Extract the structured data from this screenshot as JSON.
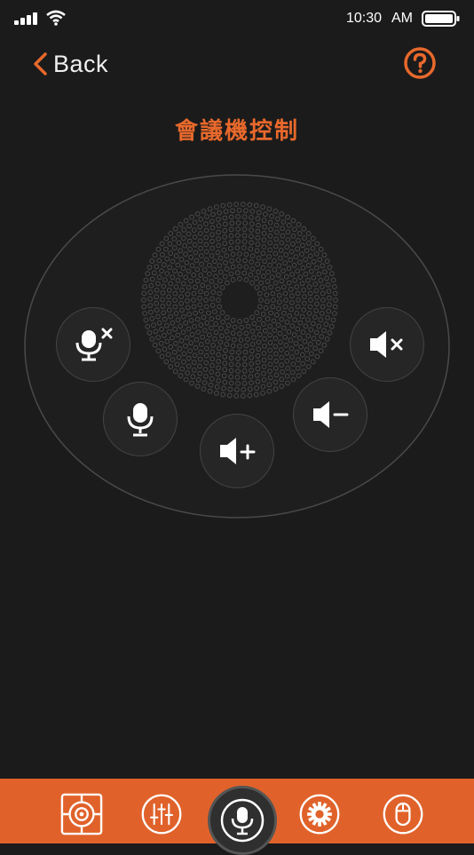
{
  "status_bar": {
    "time": "10:30",
    "ampm": "AM",
    "icons": [
      "signal-icon",
      "wifi-icon",
      "battery-icon"
    ]
  },
  "header": {
    "back_label": "Back",
    "back_icon": "chevron-left-icon",
    "help_icon": "question-circle-icon",
    "title": "會議機控制"
  },
  "controls": [
    {
      "name": "mic-mute-button",
      "icon": "mic-mute-icon"
    },
    {
      "name": "mic-button",
      "icon": "mic-icon"
    },
    {
      "name": "volume-up-button",
      "icon": "volume-up-icon"
    },
    {
      "name": "volume-down-button",
      "icon": "volume-down-icon"
    },
    {
      "name": "speaker-mute-button",
      "icon": "speaker-mute-icon"
    }
  ],
  "tab_bar": {
    "tabs": [
      {
        "name": "tab-camera",
        "icon": "camera-target-icon"
      },
      {
        "name": "tab-equalizer",
        "icon": "equalizer-icon"
      },
      {
        "name": "tab-microphone",
        "icon": "microphone-icon",
        "active": true
      },
      {
        "name": "tab-settings",
        "icon": "gear-icon"
      },
      {
        "name": "tab-mouse",
        "icon": "mouse-icon"
      }
    ]
  },
  "colors": {
    "accent": "#e8692c",
    "background": "#1b1b1b",
    "tab_bar": "#e0622a",
    "button_bg": "#262626"
  }
}
